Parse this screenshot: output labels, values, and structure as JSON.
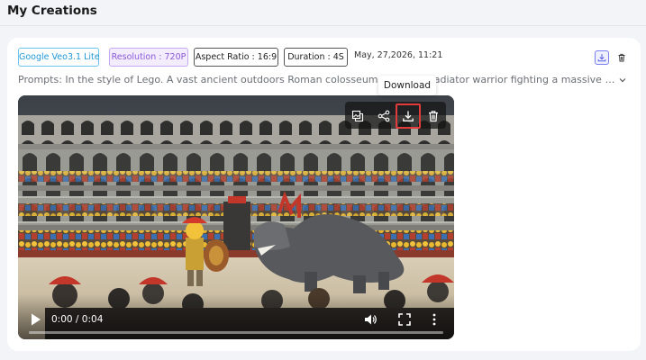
{
  "header": {
    "title": "My Creations"
  },
  "creation": {
    "tags": {
      "model": "Google Veo3.1 Lite",
      "resolution": "Resolution : 720P",
      "aspect_ratio": "Aspect Ratio : 16:9",
      "duration": "Duration : 4S"
    },
    "date": "May, 27,2026, 11:21",
    "prompt": "Prompts: In the style of Lego. A vast ancient outdoors Roman colosseum arena, a gladiator warrior fighting a massive dragon",
    "tooltip": "Download",
    "video": {
      "time": "0:00 / 0:04",
      "progress": 0.0
    },
    "icons": {
      "card_download": "download-icon",
      "card_delete": "trash-icon",
      "expand": "chevron-down-icon",
      "copy": "copy-image-icon",
      "share": "share-icon",
      "download": "download-icon",
      "delete": "trash-icon",
      "play": "play-icon",
      "volume": "volume-icon",
      "fullscreen": "fullscreen-icon",
      "more": "more-vertical-icon"
    },
    "colors": {
      "model_tag": "#1e98d6",
      "resolution_tag": "#8a5ad8",
      "download_highlight": "#e23b3b"
    }
  }
}
